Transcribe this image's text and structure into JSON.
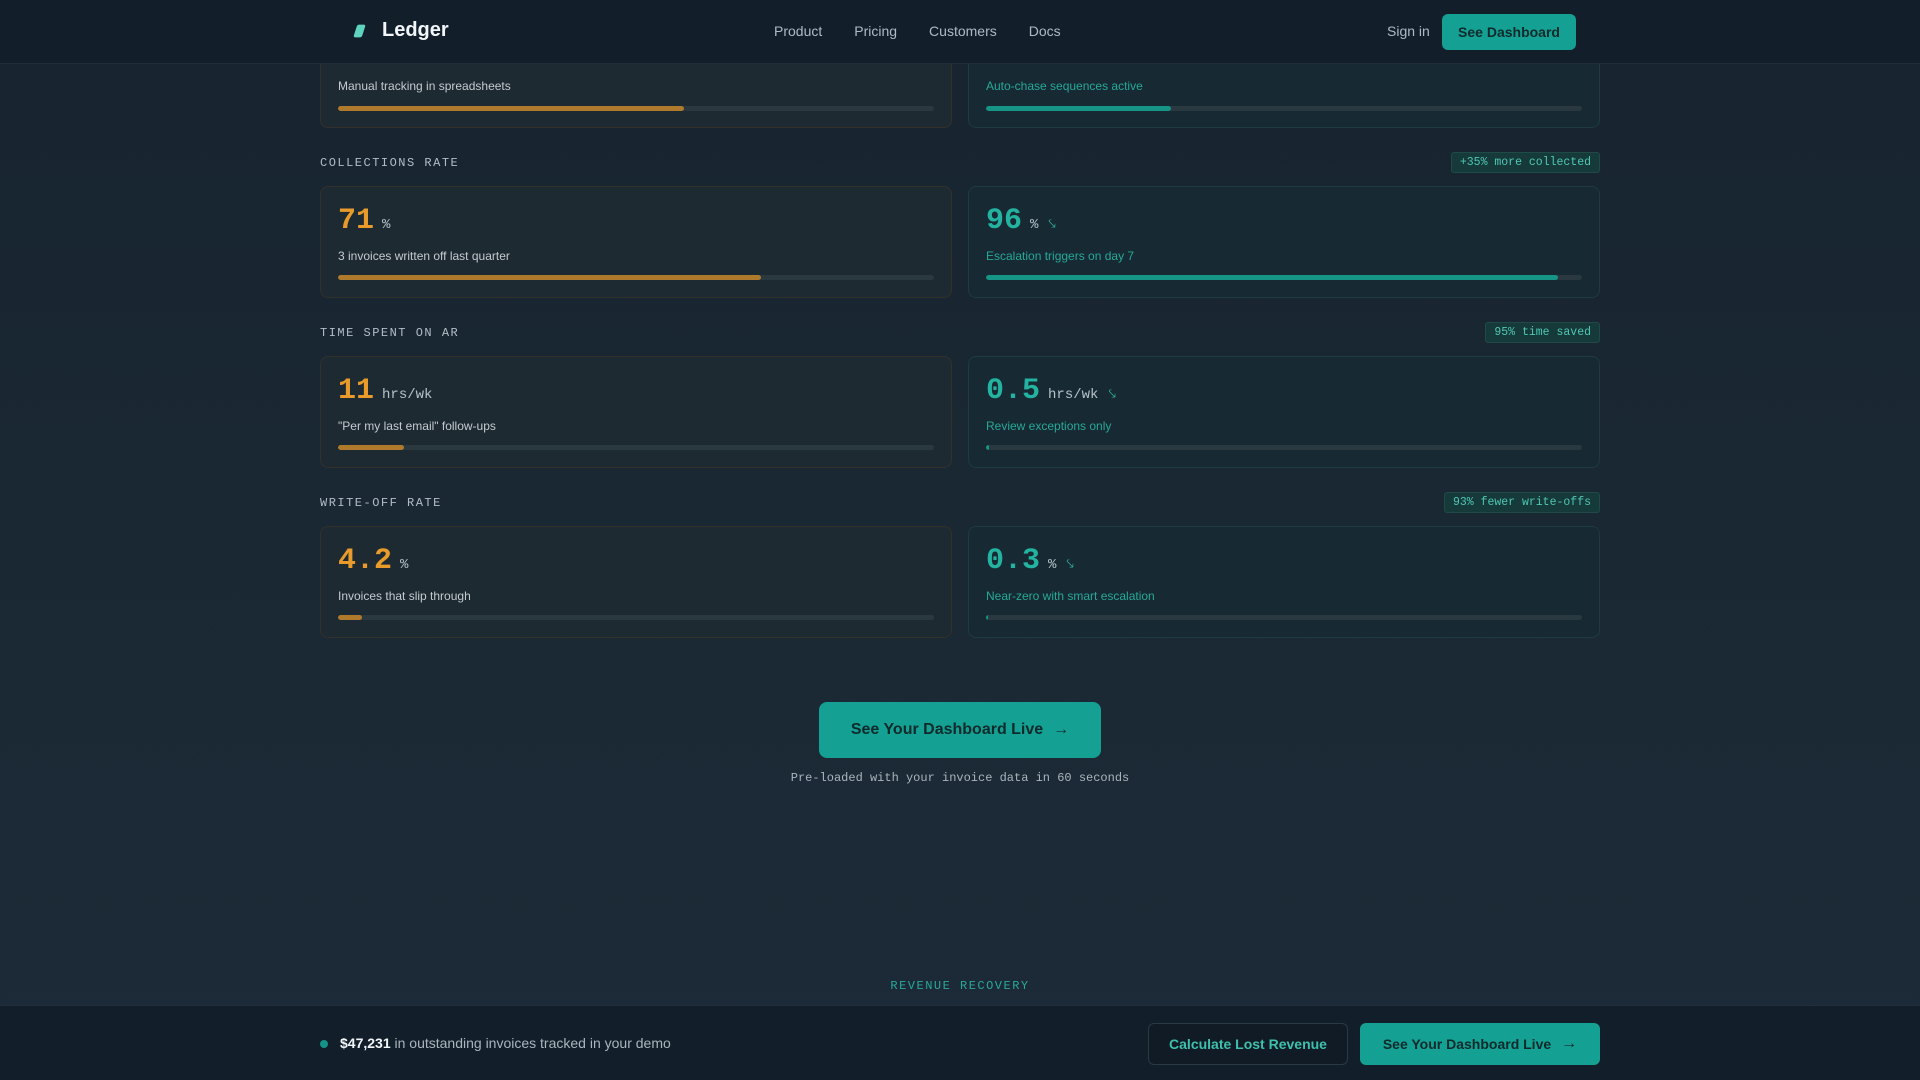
{
  "nav": {
    "brand": "Ledger",
    "links": [
      "Product",
      "Pricing",
      "Customers",
      "Docs"
    ],
    "sign_in": "Sign in",
    "cta": "See Dashboard"
  },
  "top_partial": {
    "before": {
      "note": "Manual tracking in spreadsheets",
      "progress": 0.58
    },
    "after": {
      "note": "Auto-chase sequences active",
      "progress": 0.31
    }
  },
  "sections": [
    {
      "label": "COLLECTIONS RATE",
      "badge": "+35% more collected",
      "before": {
        "value": "71",
        "unit": "%",
        "note": "3 invoices written off last quarter",
        "progress": 0.71
      },
      "after": {
        "value": "96",
        "unit": "%",
        "note": "Escalation triggers on day 7",
        "progress": 0.96
      }
    },
    {
      "label": "TIME SPENT ON AR",
      "badge": "95% time saved",
      "before": {
        "value": "11",
        "unit": "hrs/wk",
        "note": "\"Per my last email\" follow-ups",
        "progress": 0.11
      },
      "after": {
        "value": "0.5",
        "unit": "hrs/wk",
        "note": "Review exceptions only",
        "progress": 0.005
      }
    },
    {
      "label": "WRITE-OFF RATE",
      "badge": "93% fewer write-offs",
      "before": {
        "value": "4.2",
        "unit": "%",
        "note": "Invoices that slip through",
        "progress": 0.04
      },
      "after": {
        "value": "0.3",
        "unit": "%",
        "note": "Near-zero with smart escalation",
        "progress": 0.003
      }
    }
  ],
  "cta": {
    "label": "See Your Dashboard Live",
    "sub": "Pre-loaded with your invoice data in 60 seconds"
  },
  "next_section_label": "REVENUE RECOVERY",
  "bottom_bar": {
    "amount": "$47,231",
    "text": " in outstanding invoices tracked in your demo",
    "secondary": "Calculate Lost Revenue",
    "primary": "See Your Dashboard Live"
  },
  "icons": {
    "trend": "trend-down-icon",
    "arrow": "arrow-right-icon",
    "logo": "ledger-logo-icon"
  }
}
